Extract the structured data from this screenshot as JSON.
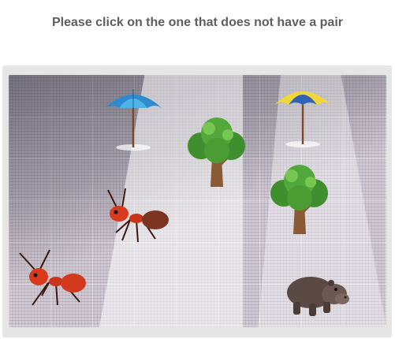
{
  "instruction": "Please click on the one that does not have a pair",
  "puzzle": {
    "items": [
      {
        "name": "umbrella-blue",
        "kind": "umbrella"
      },
      {
        "name": "umbrella-yellow",
        "kind": "umbrella"
      },
      {
        "name": "tree-top",
        "kind": "tree"
      },
      {
        "name": "tree-right",
        "kind": "tree"
      },
      {
        "name": "ant-center",
        "kind": "ant"
      },
      {
        "name": "ant-left",
        "kind": "ant"
      },
      {
        "name": "hippo",
        "kind": "hippo"
      }
    ]
  },
  "colors": {
    "instruction_text": "#5e5e5e",
    "frame_bg": "#e6e6e6"
  }
}
